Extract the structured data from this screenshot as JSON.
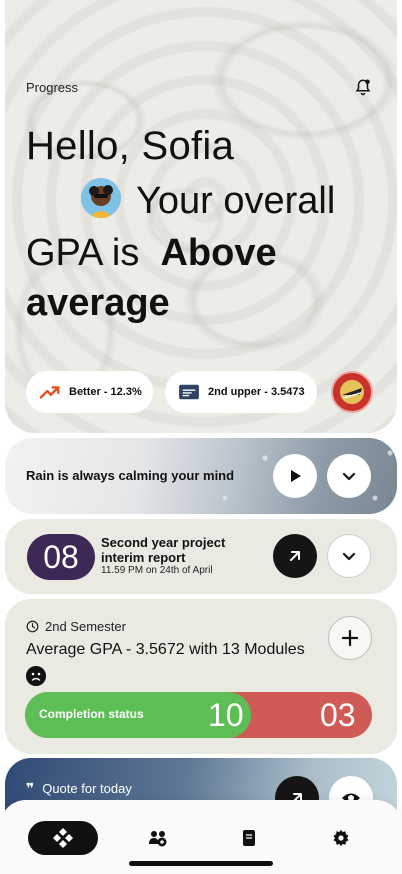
{
  "hero": {
    "label": "Progress",
    "greeting": "Hello, Sofia",
    "line1": "Your overall",
    "line2_prefix": "GPA is",
    "line2_bold": "Above",
    "line3": "average",
    "pills": [
      {
        "icon": "trending-up-icon",
        "text": "Better - 12.3%"
      },
      {
        "icon": "degree-icon",
        "text": "2nd upper - 3.5473"
      }
    ]
  },
  "rain": {
    "text": "Rain is always calming your mind"
  },
  "deadline": {
    "day": "08",
    "title": "Second year project interim report",
    "subtitle": "11.59 PM on 24th of April"
  },
  "semester": {
    "header": "2nd Semester",
    "gpa_text": "Average GPA - 3.5672 with 13 Modules",
    "status_label": "Completion status",
    "completed": "10",
    "remaining": "03",
    "completed_fraction": 0.65
  },
  "quote": {
    "label": "Quote for for today",
    "label_display": "Quote for today"
  },
  "colors": {
    "accent_orange": "#e8501e",
    "deadline_purple": "#3d2856",
    "status_green": "#5dbe55",
    "status_red": "#cf5a56"
  }
}
